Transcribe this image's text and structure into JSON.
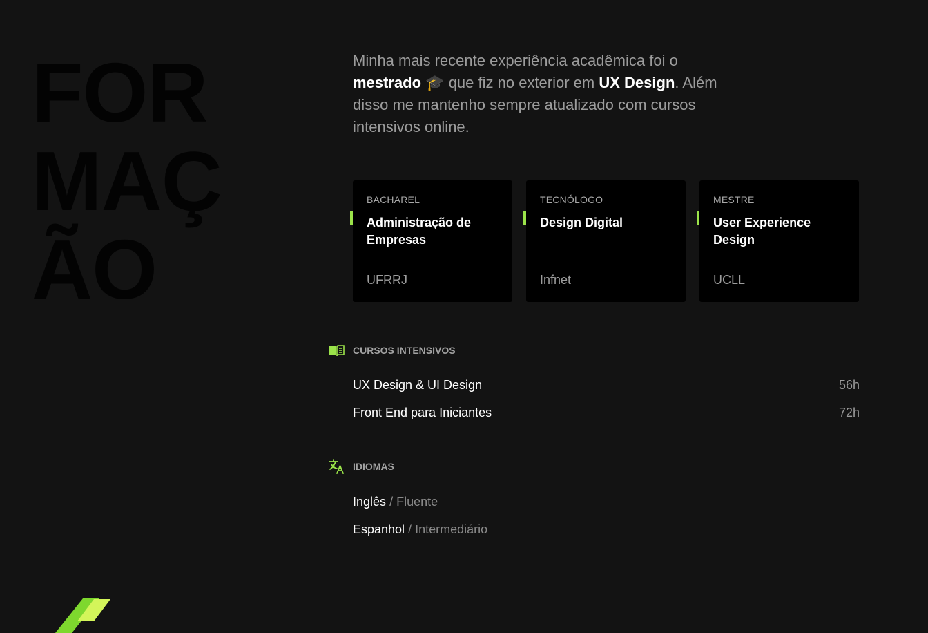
{
  "title_lines": [
    "FOR",
    "MAÇ",
    "ÃO"
  ],
  "intro": {
    "part1": "Minha mais recente experiência acadêmica foi o ",
    "bold1": "mestrado",
    "emoji": "🎓",
    "part2": " que fiz no exterior em ",
    "bold2": "UX Design",
    "part3": ". Além disso me mantenho sempre atualizado com cursos intensivos online."
  },
  "cards": [
    {
      "level": "BACHAREL",
      "name": "Administração de Empresas",
      "school": "UFRRJ"
    },
    {
      "level": "TECNÓLOGO",
      "name": "Design Digital",
      "school": "Infnet"
    },
    {
      "level": "MESTRE",
      "name": "User Experience Design",
      "school": "UCLL"
    }
  ],
  "courses": {
    "label": "CURSOS INTENSIVOS",
    "icon": "book-icon",
    "items": [
      {
        "title": "UX Design & UI Design",
        "hours": "56h"
      },
      {
        "title": "Front End para Iniciantes",
        "hours": "72h"
      }
    ]
  },
  "languages": {
    "label": "IDIOMAS",
    "icon": "translate-icon",
    "separator": "/",
    "items": [
      {
        "name": "Inglês",
        "level": "Fluente"
      },
      {
        "name": "Espanhol",
        "level": "Intermediário"
      }
    ]
  },
  "colors": {
    "background": "#131313",
    "accent": "#9be34a",
    "accent_light": "#d4f55a",
    "card": "#000000"
  }
}
